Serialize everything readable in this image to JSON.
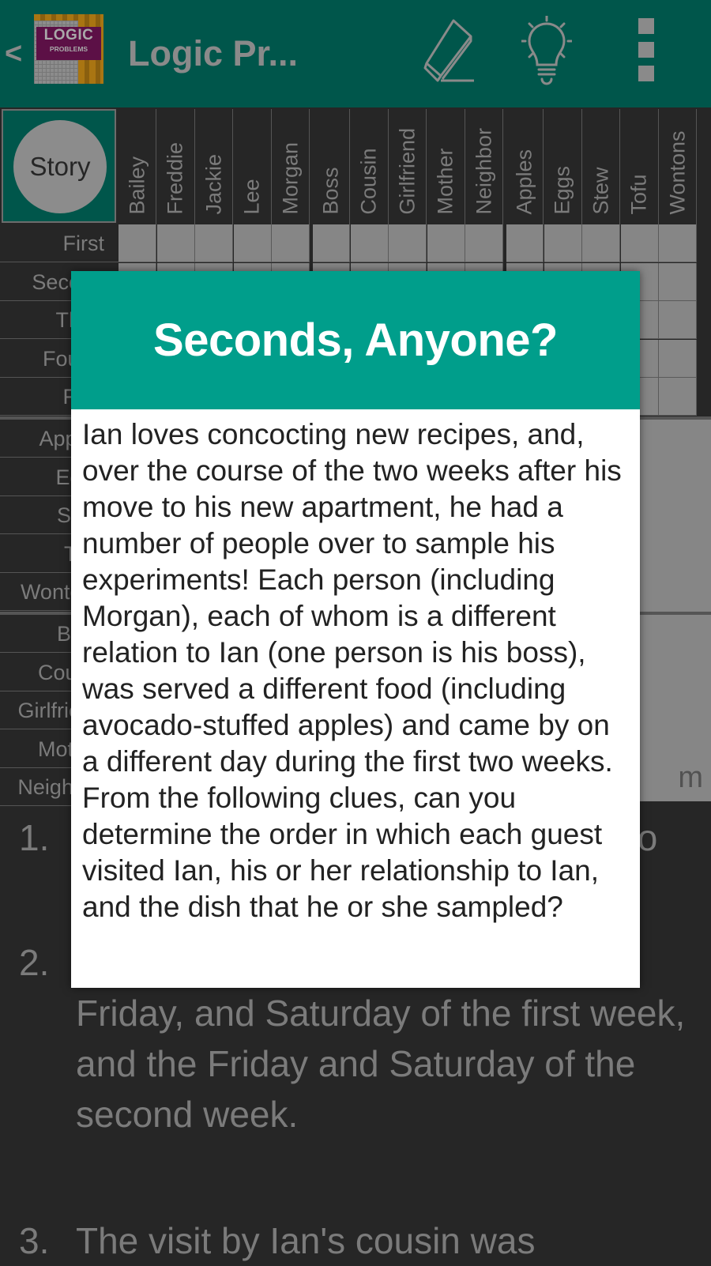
{
  "toolbar": {
    "back_label": "<",
    "logo": {
      "line1": "LOGIC",
      "line2": "PROBLEMS"
    },
    "title": "Logic Pr...",
    "icons": [
      "eraser-icon",
      "lightbulb-icon",
      "overflow-menu-icon"
    ]
  },
  "grid": {
    "story_button_label": "Story",
    "column_groups": [
      {
        "name": "people",
        "items": [
          "Bailey",
          "Freddie",
          "Jackie",
          "Lee",
          "Morgan"
        ]
      },
      {
        "name": "relations",
        "items": [
          "Boss",
          "Cousin",
          "Girlfriend",
          "Mother",
          "Neighbor"
        ]
      },
      {
        "name": "foods",
        "items": [
          "Apples",
          "Eggs",
          "Stew",
          "Tofu",
          "Wontons"
        ]
      }
    ],
    "row_groups": [
      {
        "name": "order",
        "items": [
          "First",
          "Second",
          "Third",
          "Fourth",
          "Fifth"
        ]
      },
      {
        "name": "foods",
        "items": [
          "Apples",
          "Eggs",
          "Stew",
          "Tofu",
          "Wontons"
        ]
      },
      {
        "name": "relations",
        "items": [
          "Boss",
          "Cousin",
          "Girlfriend",
          "Mother",
          "Neighbor"
        ]
      }
    ],
    "side_panel_text_fragment": "m"
  },
  "clues": [
    {
      "number": "1.",
      "text": "to"
    },
    {
      "number": "2.",
      "text": "Ian had guests on the Wednesday, Friday, and Saturday of the first week, and the Friday and Saturday of the second week."
    },
    {
      "number": "3.",
      "text": "The visit by Ian's cousin was"
    }
  ],
  "dialog": {
    "title": "Seconds, Anyone?",
    "body": "Ian loves concocting new recipes, and, over the course of the two weeks after his move to his new apartment, he had a number of people over to sample his experiments! Each person (including Morgan), each of whom is a different relation to Ian (one person is his boss), was served a different food (including avocado-stuffed apples) and came by on a different day during the first two weeks. From the following clues, can you determine the order in which each guest visited Ian, his or her relationship to Ian, and the dish that he or she sampled?"
  },
  "colors": {
    "toolbar_dimmed": "#00564b",
    "dialog_header": "#009e8b",
    "background": "#262626",
    "grid_cell": "#868686"
  }
}
